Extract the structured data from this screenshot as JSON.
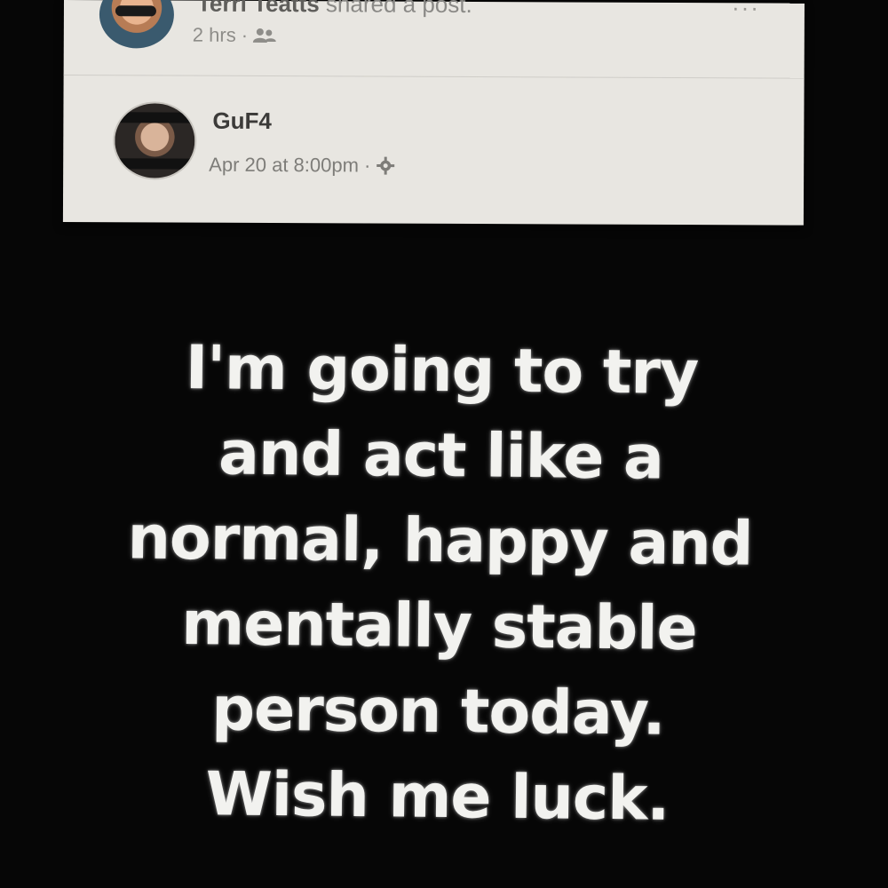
{
  "shared_header": {
    "sharer_name": "Terri Teatts",
    "action": "shared a post.",
    "time": "2 hrs",
    "separator": "·",
    "audience_icon": "friends-icon",
    "more_icon": "more-icon"
  },
  "original_post": {
    "author_name": "GuF4",
    "timestamp": "Apr 20 at 8:00pm",
    "separator": "·",
    "audience_icon": "gear-icon",
    "text_lines": [
      "I'm going to try",
      "and act like a",
      "normal, happy and",
      "mentally stable",
      "person today.",
      "Wish me luck."
    ]
  },
  "colors": {
    "card_background": "#e8e6e1",
    "post_background": "#060606",
    "post_text": "#f2f2ef"
  }
}
